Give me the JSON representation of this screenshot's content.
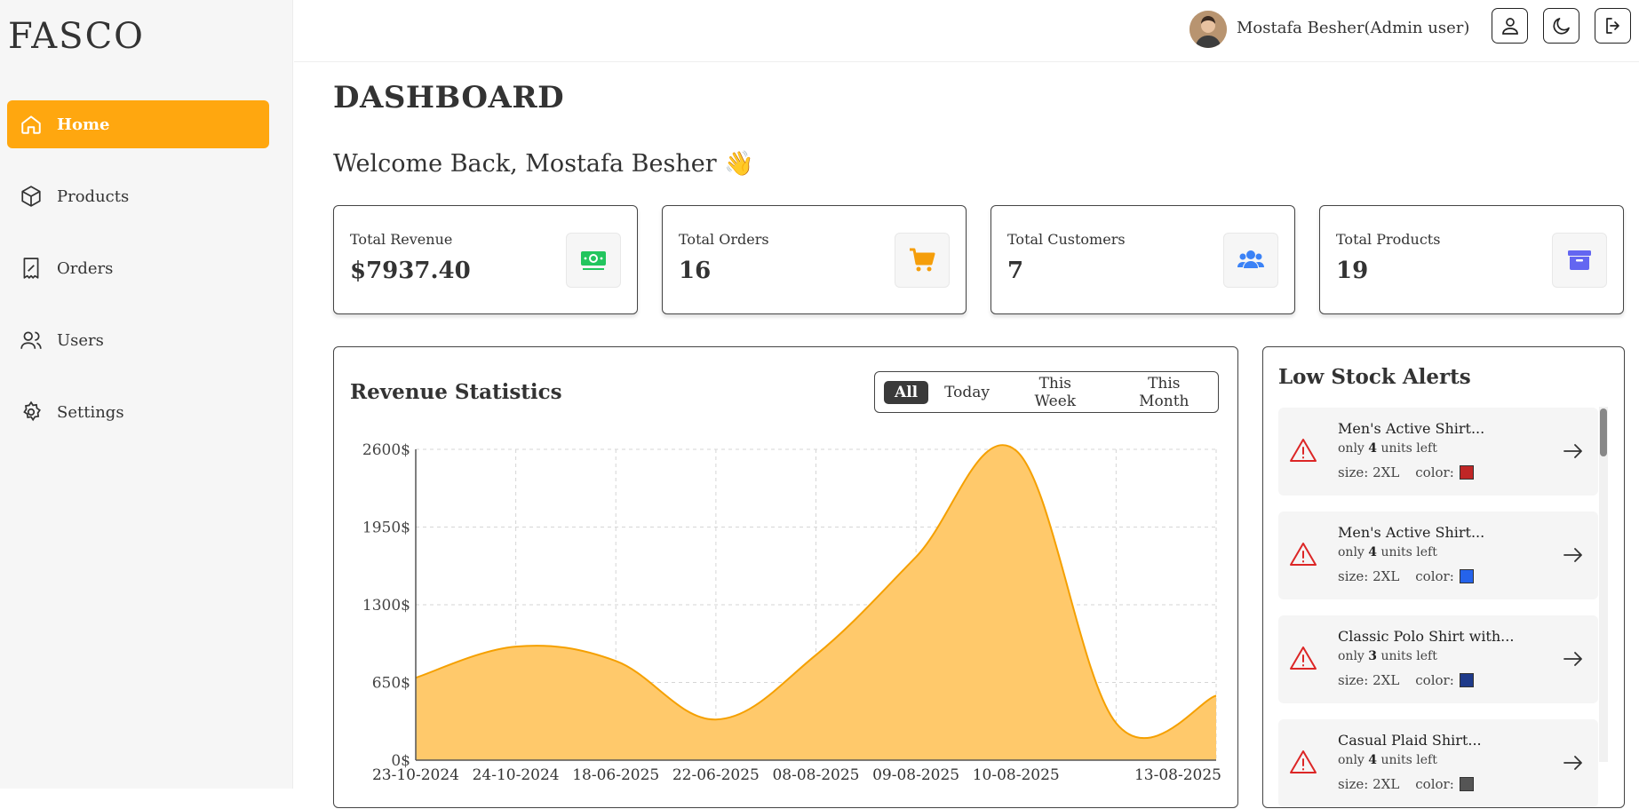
{
  "app": {
    "logo": "FASCO"
  },
  "sidebar": {
    "items": [
      {
        "label": "Home",
        "icon": "home-icon",
        "active": true
      },
      {
        "label": "Products",
        "icon": "box-icon"
      },
      {
        "label": "Orders",
        "icon": "receipt-icon"
      },
      {
        "label": "Users",
        "icon": "users-icon"
      },
      {
        "label": "Settings",
        "icon": "gear-icon"
      }
    ]
  },
  "header": {
    "user_name": "Mostafa Besher(Admin user)",
    "icons": [
      "profile-icon",
      "dark-mode-icon",
      "logout-icon"
    ]
  },
  "main": {
    "title": "DASHBOARD",
    "welcome": "Welcome Back, Mostafa Besher 👋",
    "stats": [
      {
        "label": "Total Revenue",
        "value": "$7937.40",
        "icon": "money-icon",
        "color": "#22c55e"
      },
      {
        "label": "Total Orders",
        "value": "16",
        "icon": "cart-icon",
        "color": "#f59e0b"
      },
      {
        "label": "Total Customers",
        "value": "7",
        "icon": "users-icon",
        "color": "#3b82f6"
      },
      {
        "label": "Total Products",
        "value": "19",
        "icon": "archive-icon",
        "color": "#6366f1"
      }
    ]
  },
  "revenue": {
    "title": "Revenue Statistics",
    "filters": [
      {
        "label": "All",
        "active": true
      },
      {
        "label": "Today"
      },
      {
        "label": "This Week"
      },
      {
        "label": "This Month"
      }
    ]
  },
  "chart_data": {
    "type": "area",
    "title": "",
    "xlabel": "",
    "ylabel": "",
    "x": [
      "23-10-2024",
      "24-10-2024",
      "18-06-2025",
      "22-06-2025",
      "08-08-2025",
      "09-08-2025",
      "10-08-2025",
      "",
      "13-08-2025"
    ],
    "series": [
      {
        "values": [
          690,
          950,
          830,
          340,
          880,
          1700,
          2590,
          310,
          540
        ]
      }
    ],
    "y_ticks": [
      "0$",
      "650$",
      "1300$",
      "1950$",
      "2600$"
    ],
    "ylim": [
      0,
      2600
    ],
    "grid": true,
    "colors": {
      "fill": "#ffc96b",
      "stroke": "#f5a000"
    }
  },
  "alerts": {
    "title": "Low Stock Alerts",
    "items": [
      {
        "name": "Men's Active Shirt...",
        "units_prefix": "only",
        "units": "4",
        "units_suffix": "units left",
        "size_label": "size: 2XL",
        "color_label": "color:",
        "swatch": "#c02626"
      },
      {
        "name": "Men's Active Shirt...",
        "units_prefix": "only",
        "units": "4",
        "units_suffix": "units left",
        "size_label": "size: 2XL",
        "color_label": "color:",
        "swatch": "#2563eb"
      },
      {
        "name": "Classic Polo Shirt with...",
        "units_prefix": "only",
        "units": "3",
        "units_suffix": "units left",
        "size_label": "size: 2XL",
        "color_label": "color:",
        "swatch": "#1e3a8a"
      },
      {
        "name": "Casual Plaid Shirt...",
        "units_prefix": "only",
        "units": "4",
        "units_suffix": "units left",
        "size_label": "size: 2XL",
        "color_label": "color:",
        "swatch": "#555555"
      }
    ]
  }
}
